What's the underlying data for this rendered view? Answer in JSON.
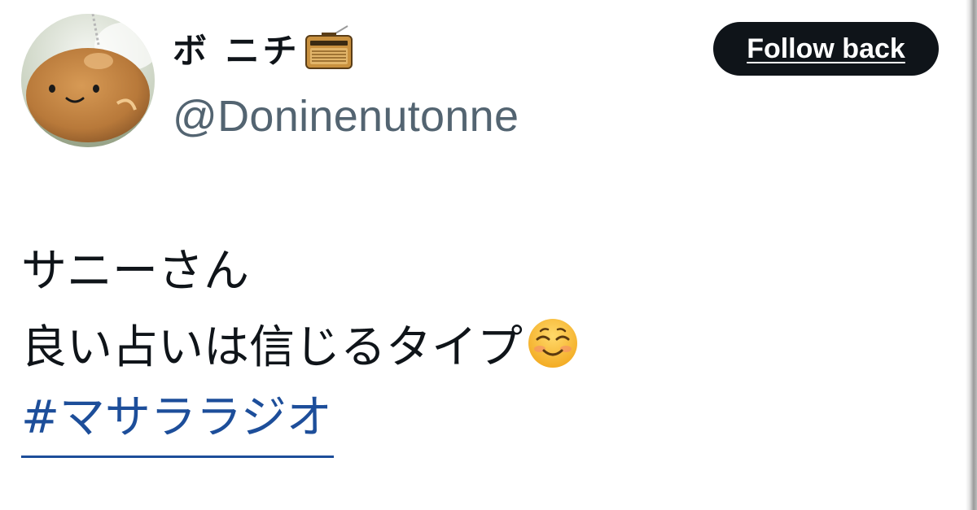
{
  "user": {
    "display_name": "ボ ニチ",
    "display_name_emoji": "radio-icon",
    "handle": "@Doninenutonne",
    "avatar": "plush-bun-avatar"
  },
  "follow_button": {
    "label": "Follow back"
  },
  "tweet": {
    "lines": [
      "サニーさん",
      "良い占いは信じるタイプ"
    ],
    "trailing_emoji": "smiling-face-icon",
    "hashtag": "#マサララジオ"
  },
  "colors": {
    "text_primary": "#0f1419",
    "text_secondary": "#536471",
    "button_bg": "#0f1419",
    "link": "#1d4e9a"
  }
}
